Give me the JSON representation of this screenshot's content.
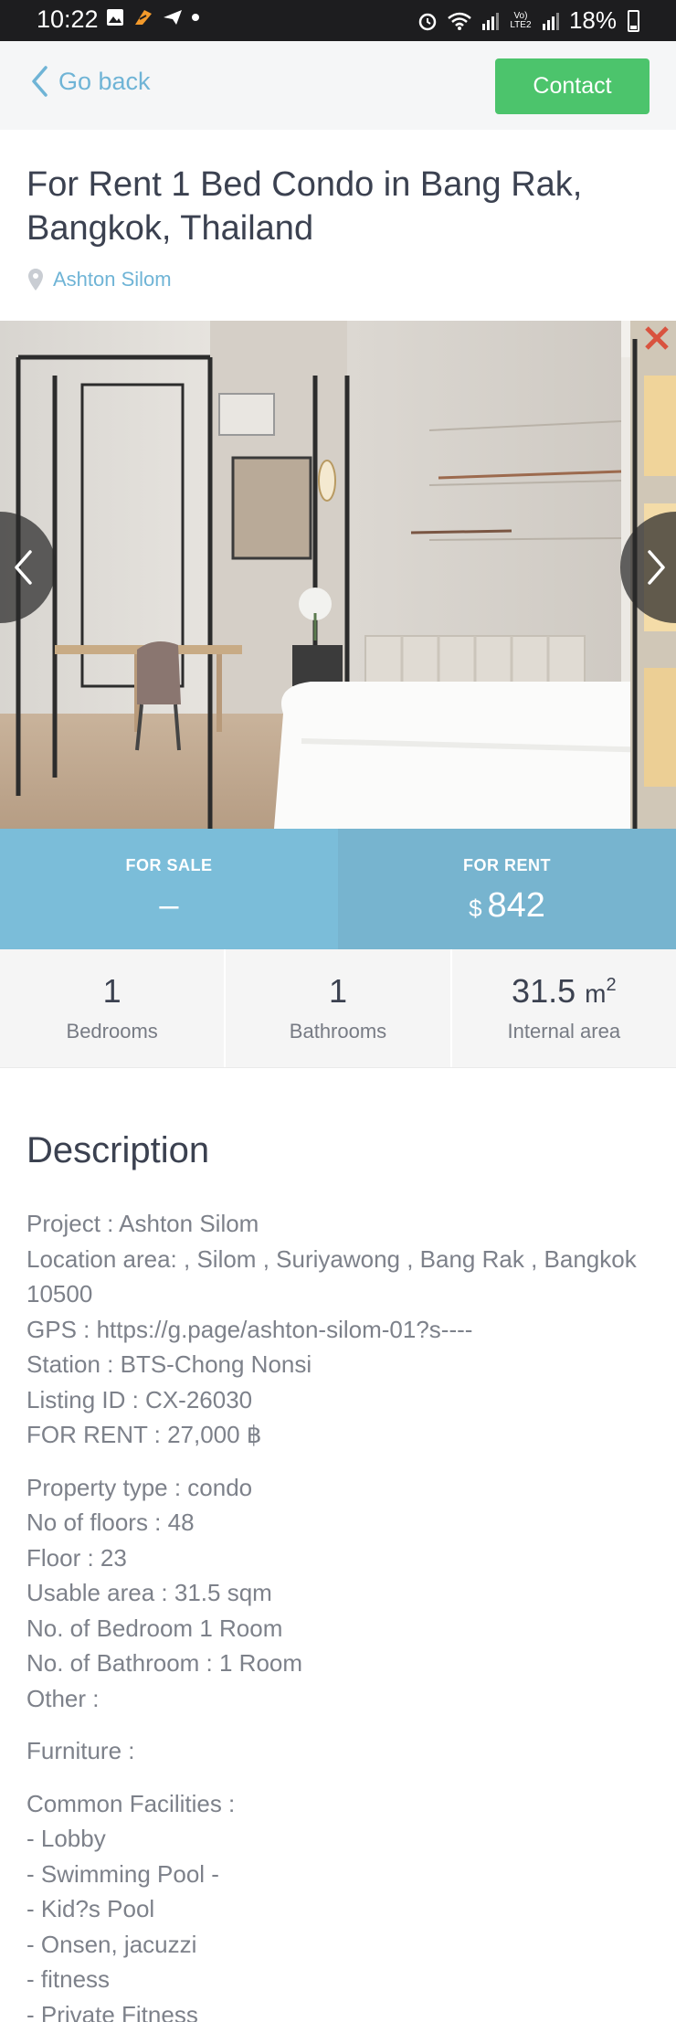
{
  "status_bar": {
    "time": "10:22",
    "battery": "18%",
    "network": "Vo) LTE2"
  },
  "header": {
    "back_label": "Go back",
    "contact_label": "Contact"
  },
  "listing": {
    "title": "For Rent 1 Bed Condo in Bang Rak, Bangkok, Thailand",
    "location": "Ashton Silom"
  },
  "pricing": {
    "sale_label": "FOR SALE",
    "sale_value": "–",
    "rent_label": "FOR RENT",
    "rent_currency": "$",
    "rent_value": "842"
  },
  "stats": {
    "bedrooms": {
      "value": "1",
      "label": "Bedrooms"
    },
    "bathrooms": {
      "value": "1",
      "label": "Bathrooms"
    },
    "area": {
      "value": "31.5",
      "unit": "m",
      "unit_sup": "2",
      "label": "Internal area"
    }
  },
  "description": {
    "heading": "Description",
    "paragraphs": [
      [
        "Project : Ashton Silom",
        "Location area: , Silom , Suriyawong , Bang Rak , Bangkok 10500",
        "GPS : https://g.page/ashton-silom-01?s----",
        "Station : BTS-Chong Nonsi",
        "Listing ID : CX-26030",
        "FOR RENT : 27,000 ฿"
      ],
      [
        "Property type : condo",
        "No of floors : 48",
        "Floor : 23",
        "Usable area : 31.5 sqm",
        "No. of Bedroom 1 Room",
        "No. of Bathroom : 1 Room",
        "Other :"
      ],
      [
        "Furniture :"
      ],
      [
        "Common Facilities :",
        "- Lobby",
        "- Swimming Pool -",
        "- Kid?s Pool",
        "- Onsen, jacuzzi",
        "- fitness",
        "- Private Fitness"
      ]
    ]
  },
  "colors": {
    "accent": "#6fb4d6",
    "contact_button": "#4cc46c",
    "price_band": "#7bbdd9"
  },
  "icons": [
    "gallery-icon",
    "notification-icon",
    "send-icon",
    "alarm-icon",
    "wifi-icon",
    "signal-icon",
    "battery-icon",
    "chevron-left-icon",
    "map-pin-icon",
    "chevron-right-icon"
  ]
}
